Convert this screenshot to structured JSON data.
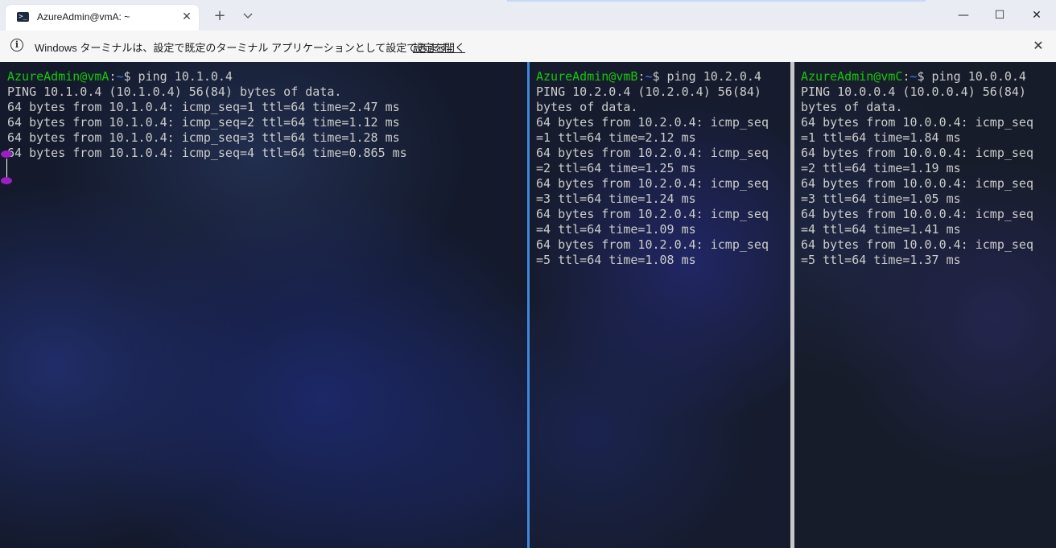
{
  "window": {
    "tab_title": "AzureAdmin@vmA: ~",
    "tab_icon": "powershell-prompt-icon",
    "controls": {
      "minimize": "—",
      "maximize": "☐",
      "close": "✕"
    }
  },
  "infobar": {
    "message": "Windows ターミナルは、設定で既定のターミナル アプリケーションとして設定できます。",
    "link": "設定を開く"
  },
  "panes": {
    "a": {
      "prompt": {
        "user": "AzureAdmin@vmA",
        "path": "~",
        "command": "$ ping 10.1.0.4"
      },
      "output": [
        "PING 10.1.0.4 (10.1.0.4) 56(84) bytes of data.",
        "64 bytes from 10.1.0.4: icmp_seq=1 ttl=64 time=2.47 ms",
        "64 bytes from 10.1.0.4: icmp_seq=2 ttl=64 time=1.12 ms",
        "64 bytes from 10.1.0.4: icmp_seq=3 ttl=64 time=1.28 ms",
        "64 bytes from 10.1.0.4: icmp_seq=4 ttl=64 time=0.865 ms"
      ]
    },
    "b": {
      "prompt": {
        "user": "AzureAdmin@vmB",
        "path": "~",
        "command": "$ ping 10.2.0.4"
      },
      "output": [
        "PING 10.2.0.4 (10.2.0.4) 56(84)",
        "bytes of data.",
        "64 bytes from 10.2.0.4: icmp_seq",
        "=1 ttl=64 time=2.12 ms",
        "64 bytes from 10.2.0.4: icmp_seq",
        "=2 ttl=64 time=1.25 ms",
        "64 bytes from 10.2.0.4: icmp_seq",
        "=3 ttl=64 time=1.24 ms",
        "64 bytes from 10.2.0.4: icmp_seq",
        "=4 ttl=64 time=1.09 ms",
        "64 bytes from 10.2.0.4: icmp_seq",
        "=5 ttl=64 time=1.08 ms"
      ]
    },
    "c": {
      "prompt": {
        "user": "AzureAdmin@vmC",
        "path": "~",
        "command": "$ ping 10.0.0.4"
      },
      "output": [
        "PING 10.0.0.4 (10.0.0.4) 56(84)",
        "bytes of data.",
        "64 bytes from 10.0.0.4: icmp_seq",
        "=1 ttl=64 time=1.84 ms",
        "64 bytes from 10.0.0.4: icmp_seq",
        "=2 ttl=64 time=1.19 ms",
        "64 bytes from 10.0.0.4: icmp_seq",
        "=3 ttl=64 time=1.05 ms",
        "64 bytes from 10.0.0.4: icmp_seq",
        "=4 ttl=64 time=1.41 ms",
        "64 bytes from 10.0.0.4: icmp_seq",
        "=5 ttl=64 time=1.37 ms"
      ]
    }
  },
  "colors": {
    "prompt_user": "#16c60c",
    "prompt_path": "#3b78ff",
    "text": "#cccccc",
    "active_pane_border": "#3f88dc",
    "selection_handle": "#9b1fc4"
  }
}
